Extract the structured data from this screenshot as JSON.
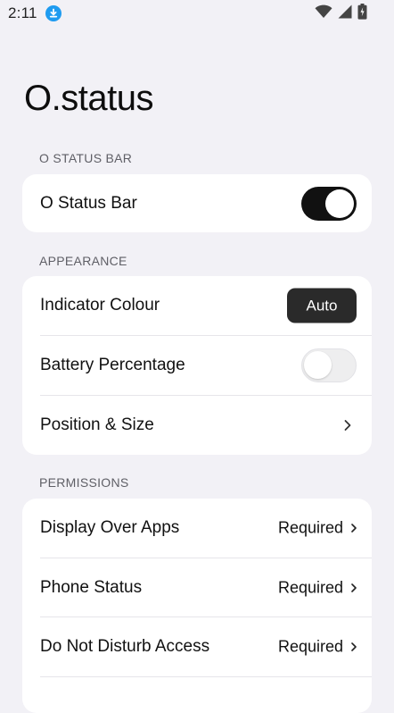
{
  "status_bar": {
    "time": "2:11",
    "download_icon": "download-icon",
    "wifi_icon": "wifi-icon",
    "signal_icon": "signal-icon",
    "battery_icon": "battery-icon",
    "accent": "#1e9bf0"
  },
  "title": "O.status",
  "sections": {
    "o_status_bar": {
      "header": "O STATUS BAR",
      "rows": {
        "status_bar": {
          "label": "O Status Bar",
          "toggle_on": true
        }
      }
    },
    "appearance": {
      "header": "APPEARANCE",
      "rows": {
        "indicator_colour": {
          "label": "Indicator Colour",
          "button_label": "Auto"
        },
        "battery_percentage": {
          "label": "Battery Percentage",
          "toggle_on": false
        },
        "position_size": {
          "label": "Position & Size",
          "icon": "chevron-right-icon"
        }
      }
    },
    "permissions": {
      "header": "PERMISSIONS",
      "rows": {
        "display_over_apps": {
          "label": "Display Over Apps",
          "value": "Required"
        },
        "phone_status": {
          "label": "Phone Status",
          "value": "Required"
        },
        "do_not_disturb": {
          "label": "Do Not Disturb Access",
          "value": "Required"
        }
      }
    }
  },
  "colors": {
    "background": "#f2f1f6",
    "card": "#ffffff",
    "toggle_on": "#111111",
    "button": "#2a2a2a"
  }
}
